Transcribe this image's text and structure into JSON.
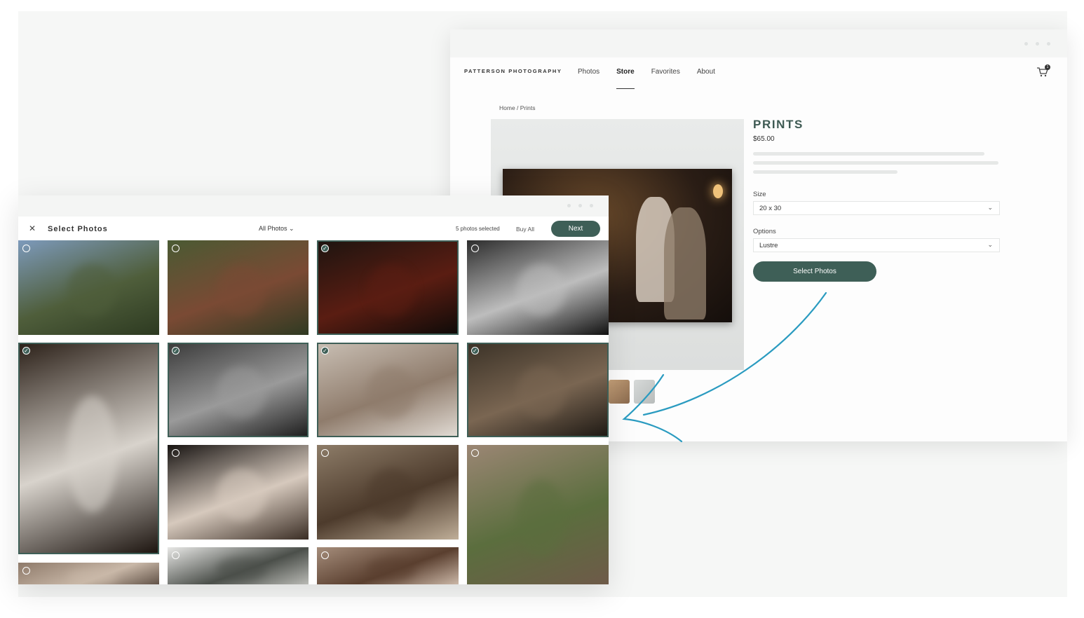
{
  "store": {
    "brand": "PATTERSON PHOTOGRAPHY",
    "nav": [
      "Photos",
      "Store",
      "Favorites",
      "About"
    ],
    "active_nav": "Store",
    "cart_count": "1",
    "breadcrumb": "Home / Prints",
    "product_title": "PRINTS",
    "price": "$65.00",
    "size_label": "Size",
    "size_value": "20 x 30",
    "options_label": "Options",
    "options_value": "Lustre",
    "select_button": "Select Photos"
  },
  "picker": {
    "title": "Select Photos",
    "filter": "All Photos",
    "selected_count": "5 photos selected",
    "buy_all": "Buy All",
    "next": "Next",
    "tiles": [
      {
        "name": "photo-tree",
        "selected": false,
        "colors": [
          "#7d9abb",
          "#4f5e3b",
          "#2d3a21"
        ]
      },
      {
        "name": "photo-cabin",
        "selected": false,
        "colors": [
          "#4a5a33",
          "#7a4a34",
          "#2f3a22"
        ]
      },
      {
        "name": "photo-lamp-room",
        "selected": true,
        "colors": [
          "#1d1410",
          "#5a1d12",
          "#0d0a08"
        ]
      },
      {
        "name": "photo-man-smiling",
        "selected": false,
        "colors": [
          "#2d2d2d",
          "#bdbdbd",
          "#111111"
        ]
      },
      {
        "name": "photo-wedding-dress",
        "selected": true,
        "colors": [
          "#2b2018",
          "#d8d3cc",
          "#1a120d"
        ]
      },
      {
        "name": "photo-bride-mirror",
        "selected": true,
        "colors": [
          "#3a3a3a",
          "#9a9a9a",
          "#1c1c1c"
        ]
      },
      {
        "name": "photo-letters",
        "selected": true,
        "colors": [
          "#c9bfb4",
          "#8f7c6c",
          "#e3ddd6"
        ]
      },
      {
        "name": "photo-hands-table",
        "selected": true,
        "colors": [
          "#3b3227",
          "#7a6652",
          "#1d1813"
        ]
      },
      {
        "name": "photo-bride-writing",
        "selected": false,
        "colors": [
          "#181412",
          "#d6c9bd",
          "#3a2d24"
        ]
      },
      {
        "name": "photo-bride-fireplace",
        "selected": false,
        "colors": [
          "#8d7c68",
          "#4d3b2c",
          "#bfae98"
        ]
      },
      {
        "name": "photo-stone-arch",
        "selected": false,
        "colors": [
          "#9b8674",
          "#5b6e3e",
          "#6e5a49"
        ]
      },
      {
        "name": "photo-crowd",
        "selected": false,
        "colors": [
          "#8e7a6a",
          "#c9b8a8",
          "#4c3d33"
        ]
      },
      {
        "name": "photo-manor",
        "selected": false,
        "colors": [
          "#e8e8e6",
          "#4b4f4a",
          "#c7c7c2"
        ]
      },
      {
        "name": "photo-interior-party",
        "selected": false,
        "colors": [
          "#a58d7b",
          "#5a3f2f",
          "#d9c6b6"
        ]
      }
    ]
  },
  "colors": {
    "accent": "#3e5f57",
    "arrow": "#2a9bc0"
  }
}
